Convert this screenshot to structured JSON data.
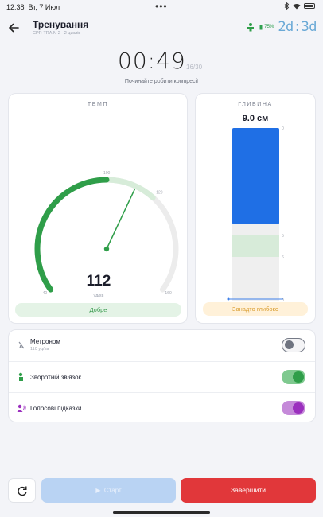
{
  "status": {
    "time": "12:38",
    "date": "Вт, 7 Июл",
    "dots": "•••"
  },
  "appbar": {
    "title": "Тренування",
    "subtitle": "CPR-TRAIN-2 · 2 циклів",
    "battery": "75%",
    "logo": "2d:3d"
  },
  "session": {
    "timer": "00:49",
    "count": "16/30",
    "hint": "Починайте робити компресії"
  },
  "tempo": {
    "label": "ТЕМП",
    "value": "112",
    "unit": "уд/хв",
    "status": "Добре",
    "scale_min": "40",
    "scale_mark1": "100",
    "scale_mark2": "120",
    "scale_max": "160",
    "gauge_min": 40,
    "gauge_max": 160,
    "target_low": 100,
    "target_high": 120,
    "current": 112
  },
  "depth": {
    "label": "ГЛИБИНА",
    "value": "9.0 см",
    "status": "Занадто глибоко",
    "tick_top": "0",
    "tick_5": "5",
    "tick_6": "6",
    "tick_bottom": "0"
  },
  "settings": {
    "metronome": {
      "label": "Метроном",
      "sub": "110 уд/хв",
      "on": false
    },
    "feedback": {
      "label": "Зворотній зв'язок",
      "on": true
    },
    "voice": {
      "label": "Голосові підказки",
      "on": true
    }
  },
  "actions": {
    "start": "Старт",
    "finish": "Завершити"
  },
  "colors": {
    "accent_blue": "#1f6fe5",
    "good_green": "#2f9e49",
    "danger_red": "#e1373a",
    "voice_purple": "#9b2fbe"
  }
}
